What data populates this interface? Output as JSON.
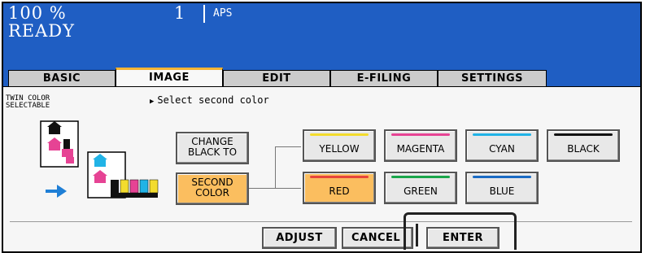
{
  "status": {
    "zoom": "100 %",
    "ready": "READY",
    "copies": "1",
    "paper": "APS",
    "accent_color": "#1f5ec3"
  },
  "tabs": [
    {
      "label": "BASIC",
      "active": false
    },
    {
      "label": "IMAGE",
      "active": true
    },
    {
      "label": "EDIT",
      "active": false
    },
    {
      "label": "E-FILING",
      "active": false
    },
    {
      "label": "SETTINGS",
      "active": false
    }
  ],
  "function": {
    "label_line1": "TWIN COLOR",
    "label_line2": "SELECTABLE",
    "instruction": "Select second color"
  },
  "mode_buttons": {
    "change_line1": "CHANGE",
    "change_line2": "BLACK TO",
    "second_line1": "SECOND",
    "second_line2": "COLOR",
    "selected": "SECOND COLOR"
  },
  "colors": {
    "row1": [
      {
        "label": "YELLOW",
        "swatch": "#f3dc2e"
      },
      {
        "label": "MAGENTA",
        "swatch": "#e64394"
      },
      {
        "label": "CYAN",
        "swatch": "#21b3e6"
      },
      {
        "label": "BLACK",
        "swatch": "#111111"
      }
    ],
    "row2": [
      {
        "label": "RED",
        "swatch": "#e8453a",
        "selected": true
      },
      {
        "label": "GREEN",
        "swatch": "#1aa64a"
      },
      {
        "label": "BLUE",
        "swatch": "#1a6bc4"
      }
    ],
    "selected_color": "#fbbe5f"
  },
  "actions": {
    "adjust": "ADJUST",
    "cancel": "CANCEL",
    "enter": "ENTER"
  }
}
